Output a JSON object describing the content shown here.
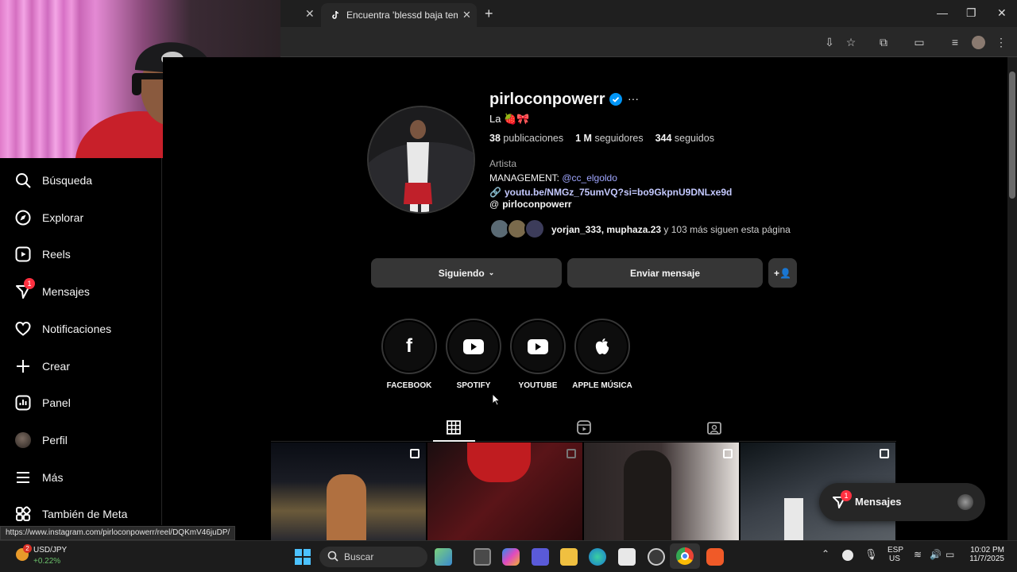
{
  "browser": {
    "tab_active_title": "Encuentra 'blessd baja temas d...",
    "new_tab": "+",
    "status_url": "https://www.instagram.com/pirloconpowerr/reel/DQKmV46juDP/"
  },
  "sidebar": {
    "items": [
      {
        "label": "Búsqueda",
        "icon": "search-icon"
      },
      {
        "label": "Explorar",
        "icon": "compass-icon"
      },
      {
        "label": "Reels",
        "icon": "reels-icon"
      },
      {
        "label": "Mensajes",
        "icon": "messenger-icon",
        "badge": "1"
      },
      {
        "label": "Notificaciones",
        "icon": "heart-icon"
      },
      {
        "label": "Crear",
        "icon": "plus-icon"
      },
      {
        "label": "Panel",
        "icon": "chart-icon"
      },
      {
        "label": "Perfil",
        "icon": "avatar-icon"
      },
      {
        "label": "Más",
        "icon": "menu-icon"
      },
      {
        "label": "También de Meta",
        "icon": "meta-icon"
      }
    ]
  },
  "profile": {
    "username": "pirloconpowerr",
    "more": "···",
    "bio_line": "La 🍓🎀",
    "stats": {
      "posts_count": "38",
      "posts_label": "publicaciones",
      "followers_count": "1 M",
      "followers_label": "seguidores",
      "following_count": "344",
      "following_label": "seguidos"
    },
    "category": "Artista",
    "management_prefix": "MANAGEMENT: ",
    "management_handle": "@cc_elgoldo",
    "link": "youtu.be/NMGz_75umVQ?si=bo9GkpnU9DNLxe9d",
    "threads": "pirloconpowerr",
    "followed_by_names": "yorjan_333, muphaza.23",
    "followed_by_rest": " y 103 más siguen esta página",
    "buttons": {
      "following": "Siguiendo",
      "message": "Enviar mensaje"
    },
    "highlights": [
      {
        "label": "FACEBOOK",
        "icon": "facebook-icon"
      },
      {
        "label": "SPOTIFY",
        "icon": "youtube-icon"
      },
      {
        "label": "YOUTUBE",
        "icon": "youtube-icon"
      },
      {
        "label": "APPLE MÚSICA",
        "icon": "apple-icon"
      }
    ]
  },
  "messages_bubble": {
    "label": "Mensajes",
    "badge": "1"
  },
  "taskbar": {
    "ticker": "USD/JPY",
    "ticker_change": "+0.22%",
    "badge": "2",
    "search": "Buscar",
    "lang_1": "ESP",
    "lang_2": "US",
    "time": "10:02 PM",
    "date": "11/7/2025"
  },
  "colors": {
    "accent": "#4150f7",
    "link": "#e0f1ff",
    "badge": "#ff3040",
    "verified": "#0095f6"
  }
}
